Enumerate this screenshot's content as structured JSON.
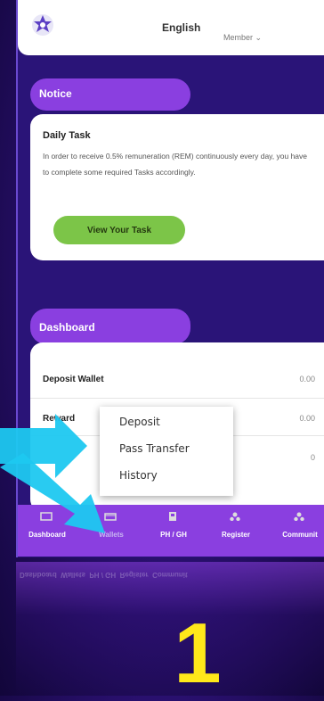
{
  "header": {
    "language": "English",
    "member_label": "Member ⌄"
  },
  "notice": {
    "tab_label": "Notice",
    "title": "Daily Task",
    "body": "In order to receive 0.5% remuneration (REM) continuously every day, you have to complete some required Tasks accordingly.",
    "button_label": "View Your Task"
  },
  "dashboard": {
    "tab_label": "Dashboard",
    "rows": [
      {
        "label": "Deposit Wallet",
        "value": "0.00"
      },
      {
        "label": "Reward",
        "value": "0.00"
      },
      {
        "label": "",
        "value": "0"
      }
    ]
  },
  "dropdown": {
    "items": [
      "Deposit",
      "Pass Transfer",
      "History"
    ]
  },
  "navbar": {
    "items": [
      {
        "label": "Dashboard",
        "icon": "dashboard-icon"
      },
      {
        "label": "Wallets",
        "icon": "wallet-icon"
      },
      {
        "label": "PH / GH",
        "icon": "ph-gh-icon"
      },
      {
        "label": "Register",
        "icon": "register-icon"
      },
      {
        "label": "Communit",
        "icon": "community-icon"
      }
    ]
  },
  "annotation": {
    "step_number": "1"
  },
  "colors": {
    "accent_purple": "#8a3fe0",
    "button_green": "#7cc548",
    "arrow_cyan": "#1ec8f0",
    "step_yellow": "#ffe81a"
  }
}
